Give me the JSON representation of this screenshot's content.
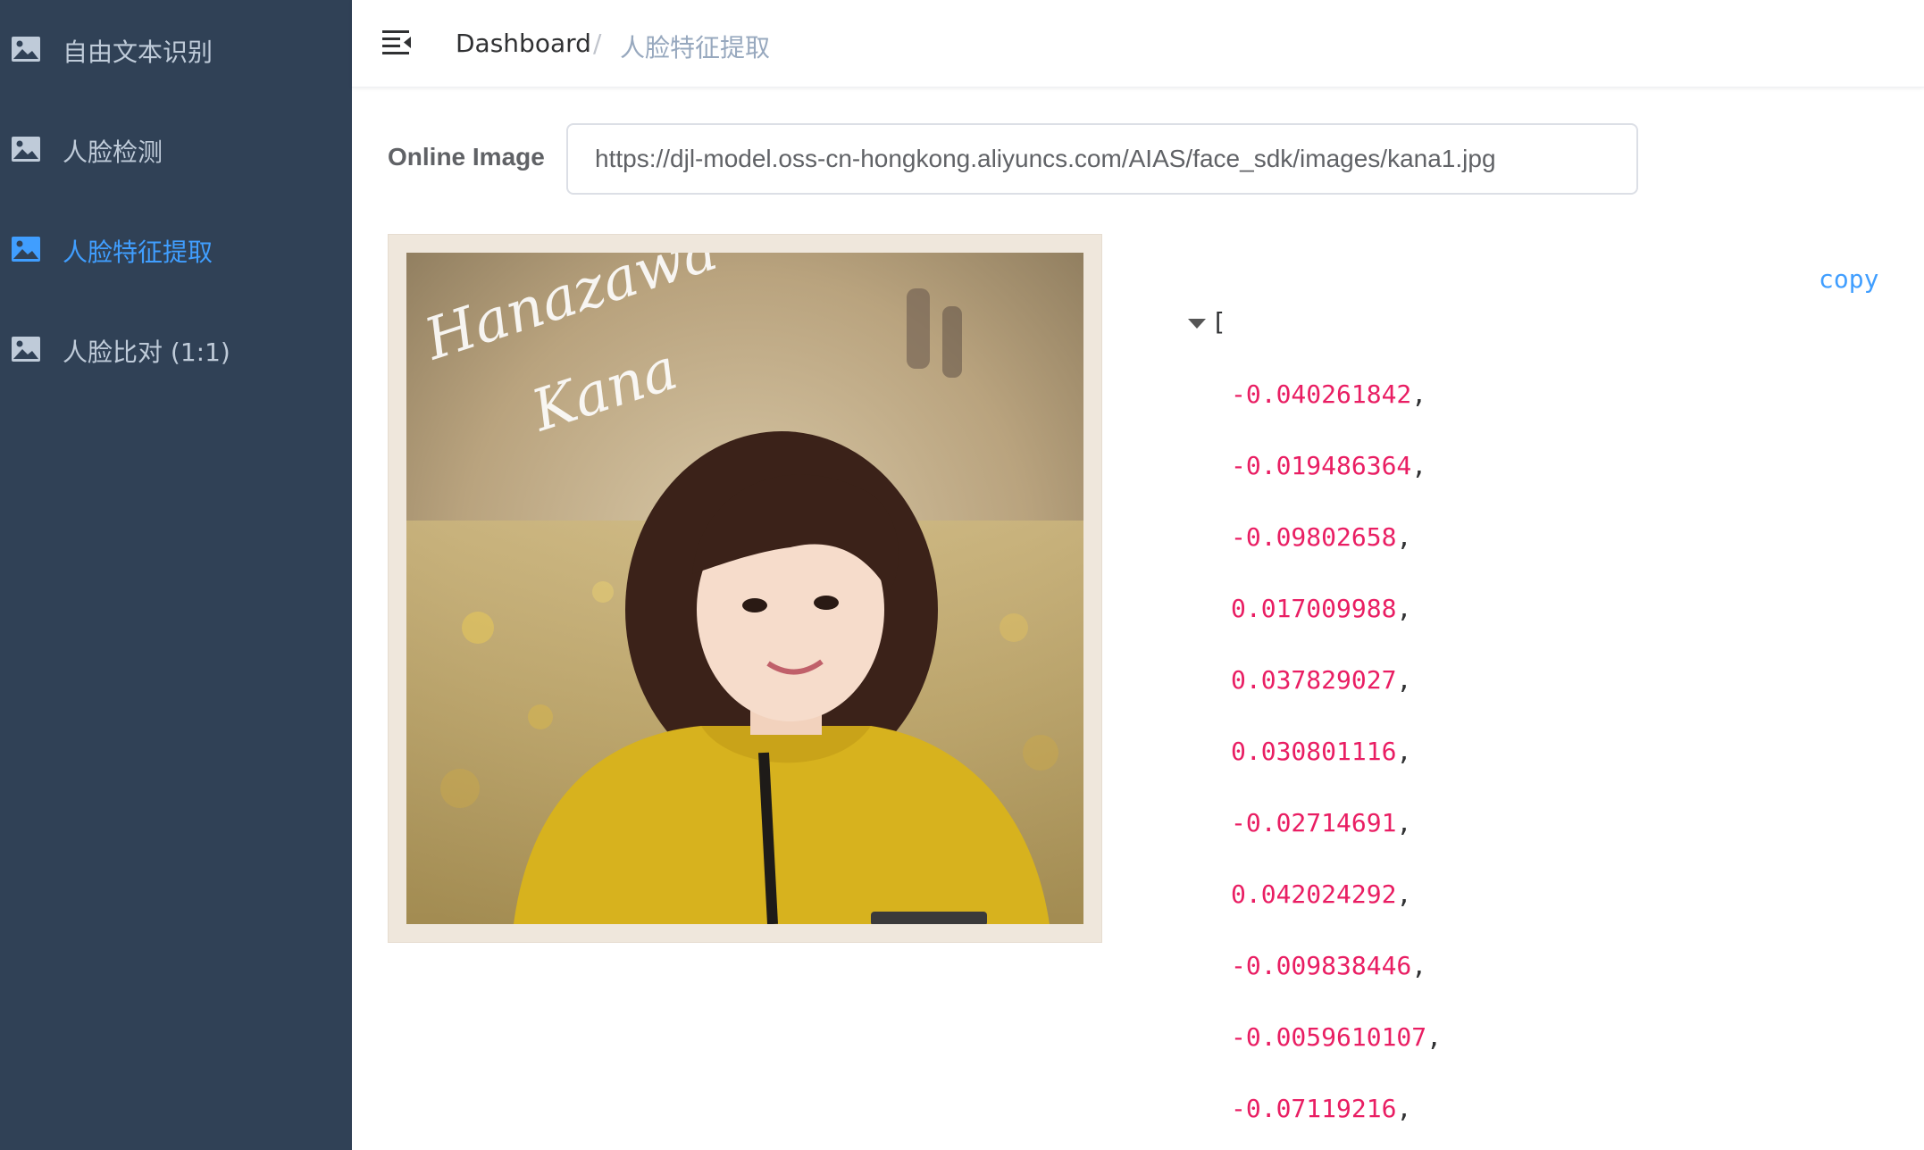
{
  "sidebar": {
    "items": [
      {
        "label": "自由文本识别",
        "icon": "image-icon",
        "active": false
      },
      {
        "label": "人脸检测",
        "icon": "image-icon",
        "active": false
      },
      {
        "label": "人脸特征提取",
        "icon": "image-icon",
        "active": true
      },
      {
        "label": "人脸比对 (1:1)",
        "icon": "image-icon",
        "active": false
      }
    ]
  },
  "navbar": {
    "breadcrumb": {
      "home": "Dashboard",
      "separator": "/",
      "current": "人脸特征提取"
    }
  },
  "form": {
    "label": "Online Image",
    "url_value": "https://djl-model.oss-cn-hongkong.aliyuncs.com/AIAS/face_sdk/images/kana1.jpg"
  },
  "image": {
    "signature_text": "Hanazawa Kana"
  },
  "json_viewer": {
    "copy_label": "copy",
    "open_bracket": "[",
    "values": [
      "-0.040261842",
      "-0.019486364",
      "-0.09802658",
      "0.017009988",
      "0.037829027",
      "0.030801116",
      "-0.02714691",
      "0.042024292",
      "-0.009838446",
      "-0.0059610107",
      "-0.07119216"
    ],
    "separator": ","
  },
  "colors": {
    "sidebar_bg": "#304156",
    "sidebar_text": "#bfcbd9",
    "accent": "#409eff",
    "json_number": "#e91e63"
  }
}
